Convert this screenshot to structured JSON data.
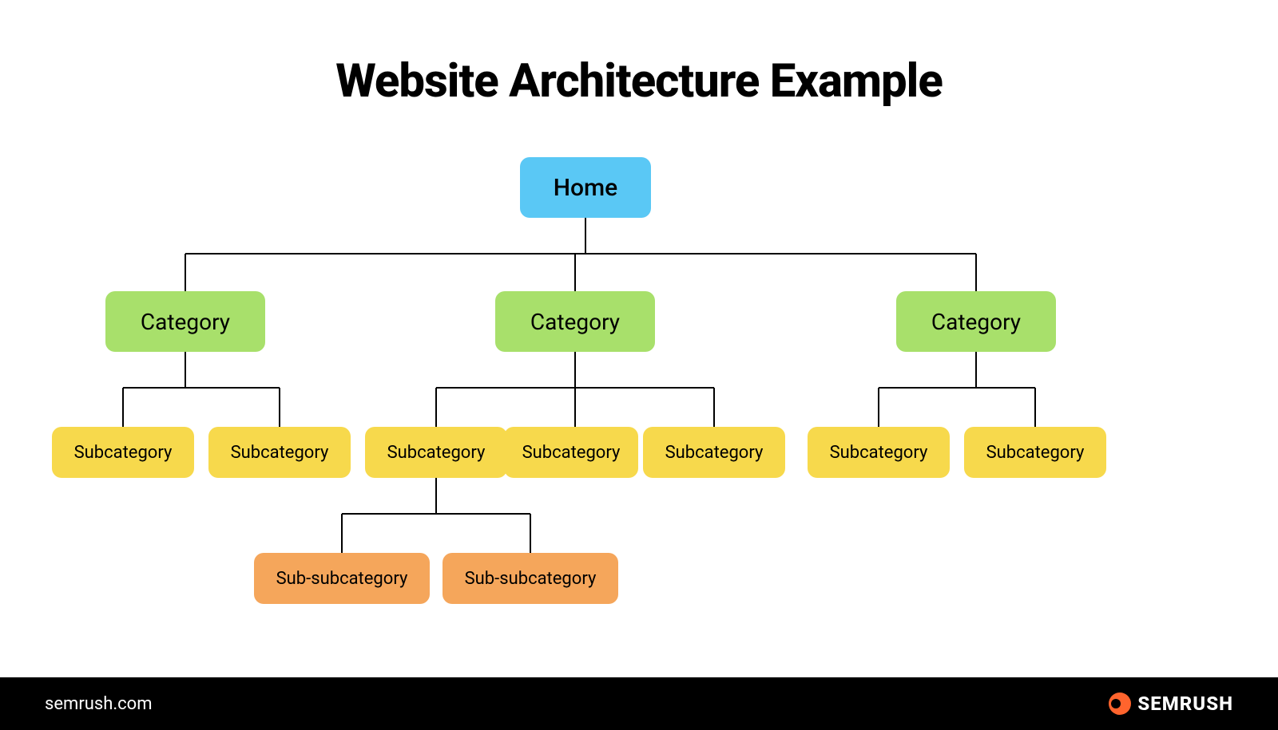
{
  "title": "Website Architecture Example",
  "home": "Home",
  "categories": [
    {
      "label": "Category",
      "sub": [
        "Subcategory",
        "Subcategory"
      ]
    },
    {
      "label": "Category",
      "sub": [
        "Subcategory",
        "Subcategory",
        "Subcategory"
      ],
      "subsub": [
        "Sub-subcategory",
        "Sub-subcategory"
      ]
    },
    {
      "label": "Category",
      "sub": [
        "Subcategory",
        "Subcategory"
      ]
    }
  ],
  "footer": {
    "site": "semrush.com",
    "brand": "SEMRUSH"
  },
  "colors": {
    "home": "#5ac8f5",
    "category": "#a8e06b",
    "subcategory": "#f7d94c",
    "subsubcategory": "#f5a65b",
    "footer": "#000",
    "accent": "#ff642d"
  }
}
